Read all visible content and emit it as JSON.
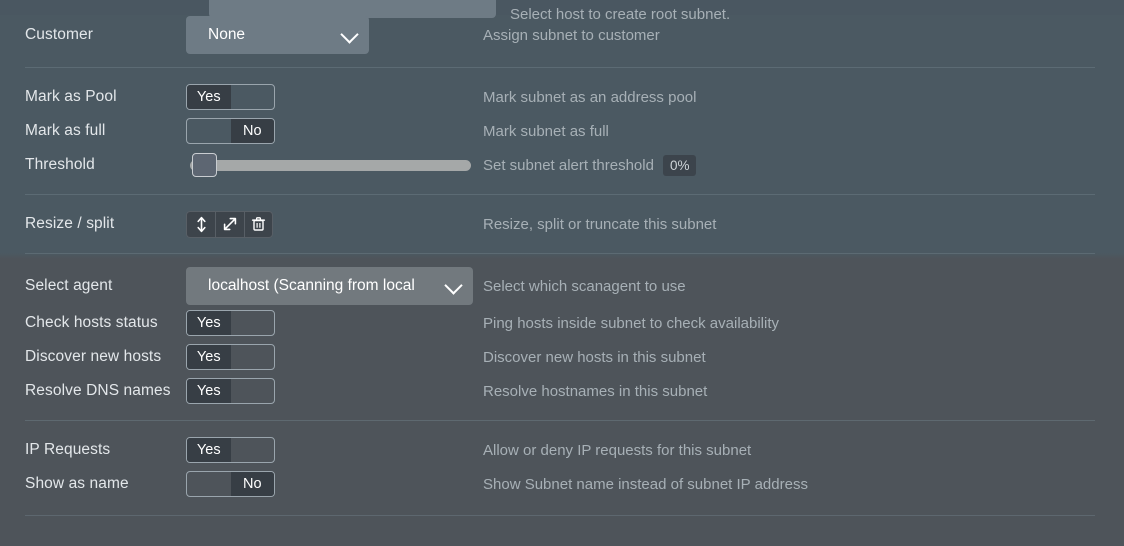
{
  "clipped_top": {
    "description": "Select host to create root subnet.",
    "select_value": ""
  },
  "sections": [
    {
      "name": "assignment",
      "rows": [
        {
          "label": "Customer",
          "control": {
            "type": "select",
            "value": "None",
            "width": "narrow"
          },
          "description": "Assign subnet to customer"
        }
      ]
    },
    {
      "name": "pool-and-threshold",
      "rows": [
        {
          "label": "Mark as Pool",
          "control": {
            "type": "toggle",
            "value": "Yes",
            "on_label": "Yes",
            "off_label": "No"
          },
          "description": "Mark subnet as an address pool"
        },
        {
          "label": "Mark as full",
          "control": {
            "type": "toggle",
            "value": "No",
            "on_label": "Yes",
            "off_label": "No"
          },
          "description": "Mark subnet as full"
        },
        {
          "label": "Threshold",
          "control": {
            "type": "slider",
            "value": 0,
            "min": 0,
            "max": 100
          },
          "description": "Set subnet alert threshold",
          "badge": "0%"
        }
      ]
    },
    {
      "name": "resize",
      "rows": [
        {
          "label": "Resize / split",
          "control": {
            "type": "button-group",
            "buttons": [
              {
                "icon": "resize-vertical-icon",
                "title": "Resize"
              },
              {
                "icon": "split-expand-icon",
                "title": "Split"
              },
              {
                "icon": "trash-icon",
                "title": "Truncate"
              }
            ]
          },
          "description": "Resize, split or truncate this subnet"
        }
      ]
    },
    {
      "name": "scanning",
      "rows": [
        {
          "label": "Select agent",
          "control": {
            "type": "select",
            "value": "localhost (Scanning from local",
            "width": "wide"
          },
          "description": "Select which scanagent to use"
        },
        {
          "label": "Check hosts status",
          "control": {
            "type": "toggle",
            "value": "Yes",
            "on_label": "Yes",
            "off_label": "No"
          },
          "description": "Ping hosts inside subnet to check availability"
        },
        {
          "label": "Discover new hosts",
          "control": {
            "type": "toggle",
            "value": "Yes",
            "on_label": "Yes",
            "off_label": "No"
          },
          "description": "Discover new hosts in this subnet"
        },
        {
          "label": "Resolve DNS names",
          "control": {
            "type": "toggle",
            "value": "Yes",
            "on_label": "Yes",
            "off_label": "No"
          },
          "description": "Resolve hostnames in this subnet"
        }
      ]
    },
    {
      "name": "requests-and-display",
      "rows": [
        {
          "label": "IP Requests",
          "control": {
            "type": "toggle",
            "value": "Yes",
            "on_label": "Yes",
            "off_label": "No"
          },
          "description": "Allow or deny IP requests for this subnet"
        },
        {
          "label": "Show as name",
          "control": {
            "type": "toggle",
            "value": "No",
            "on_label": "Yes",
            "off_label": "No"
          },
          "description": "Show Subnet name instead of subnet IP address"
        }
      ]
    }
  ],
  "colors": {
    "background_top": "#4b5962",
    "background_bottom": "#4e545a",
    "label_text": "#e3e7ea",
    "description_text": "#a7b0b6",
    "select_background": "#6e7b85",
    "toggle_on_background": "#373e45",
    "slider_track": "#a5a8a8",
    "divider": "#6c7a83"
  }
}
